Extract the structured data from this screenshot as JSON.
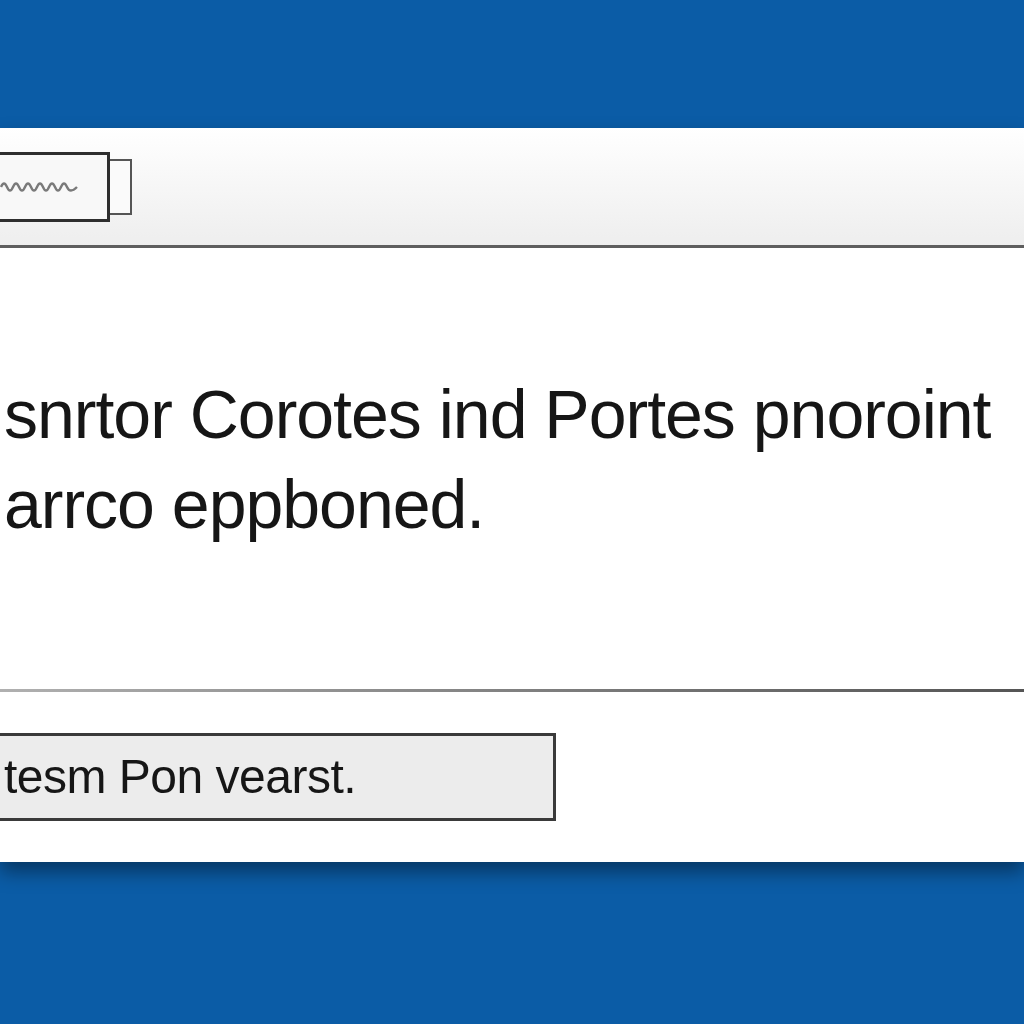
{
  "message": {
    "text": "snrtor Corotes ind Portes pnoroint\narrco eppboned."
  },
  "footer": {
    "button": {
      "label": "tesm Pon vearst."
    }
  }
}
